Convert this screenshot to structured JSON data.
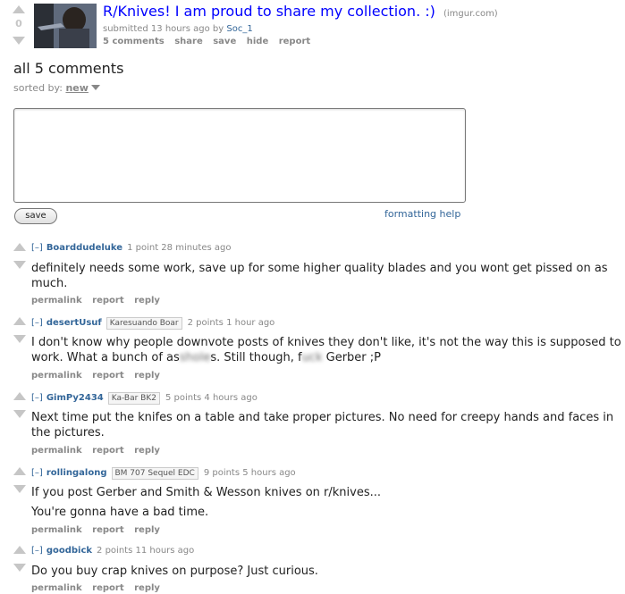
{
  "post": {
    "score": "0",
    "title": "R/Knives! I am proud to share my collection. :)",
    "domain": "(imgur.com)",
    "submitted_prefix": "submitted 13 hours ago by",
    "author": "Soc_1",
    "buttons": [
      "5 comments",
      "share",
      "save",
      "hide",
      "report"
    ]
  },
  "comments_header": "all 5 comments",
  "sort": {
    "label": "sorted by:",
    "value": "new"
  },
  "comment_form": {
    "save_label": "save",
    "formatting_help": "formatting help"
  },
  "comments": [
    {
      "toggle": "[–]",
      "user": "Boarddudeluke",
      "flair": "",
      "meta": "1 point 28 minutes ago",
      "lines": [
        "definitely needs some work, save up for some higher quality blades and you wont get pissed on as",
        "much."
      ],
      "buttons": [
        "permalink",
        "report",
        "reply"
      ]
    },
    {
      "toggle": "[–]",
      "user": "desertUsuf",
      "flair": "Karesuando Boar",
      "meta": "2 points 1 hour ago",
      "lines": [
        "I don't know why people downvote posts of knives they don't like, it's not the way this is supposed to"
      ],
      "line2_parts": [
        "work. What a bunch of as",
        "shole",
        "s. Still though, f",
        "uck",
        " Gerber ;P"
      ],
      "buttons": [
        "permalink",
        "report",
        "reply"
      ]
    },
    {
      "toggle": "[–]",
      "user": "GimPy2434",
      "flair": "Ka-Bar BK2",
      "meta": "5 points 4 hours ago",
      "lines": [
        "Next time put the knifes on a table and take proper pictures. No need for creepy hands and faces in",
        "the pictures."
      ],
      "buttons": [
        "permalink",
        "report",
        "reply"
      ]
    },
    {
      "toggle": "[–]",
      "user": "rollingalong",
      "flair": "BM 707 Sequel EDC",
      "meta": "9 points 5 hours ago",
      "lines": [
        "If you post Gerber and Smith & Wesson knives on r/knives...",
        "You're gonna have a bad time."
      ],
      "buttons": [
        "permalink",
        "report",
        "reply"
      ]
    },
    {
      "toggle": "[–]",
      "user": "goodbick",
      "flair": "",
      "meta": "2 points 11 hours ago",
      "lines": [
        "Do you buy crap knives on purpose? Just curious."
      ],
      "buttons": [
        "permalink",
        "report",
        "reply"
      ]
    }
  ]
}
